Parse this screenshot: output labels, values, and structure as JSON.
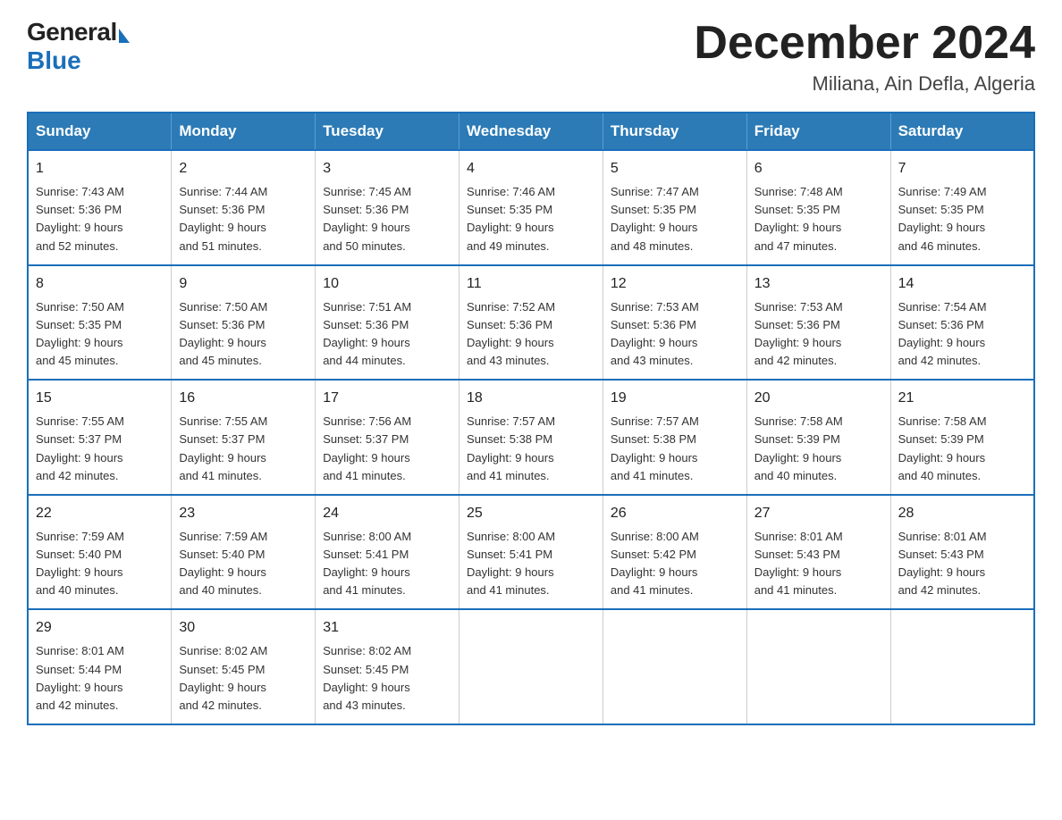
{
  "header": {
    "logo": {
      "general": "General",
      "blue": "Blue"
    },
    "title": "December 2024",
    "location": "Miliana, Ain Defla, Algeria"
  },
  "days_of_week": [
    "Sunday",
    "Monday",
    "Tuesday",
    "Wednesday",
    "Thursday",
    "Friday",
    "Saturday"
  ],
  "weeks": [
    [
      {
        "day": "1",
        "sunrise": "7:43 AM",
        "sunset": "5:36 PM",
        "daylight": "9 hours and 52 minutes."
      },
      {
        "day": "2",
        "sunrise": "7:44 AM",
        "sunset": "5:36 PM",
        "daylight": "9 hours and 51 minutes."
      },
      {
        "day": "3",
        "sunrise": "7:45 AM",
        "sunset": "5:36 PM",
        "daylight": "9 hours and 50 minutes."
      },
      {
        "day": "4",
        "sunrise": "7:46 AM",
        "sunset": "5:35 PM",
        "daylight": "9 hours and 49 minutes."
      },
      {
        "day": "5",
        "sunrise": "7:47 AM",
        "sunset": "5:35 PM",
        "daylight": "9 hours and 48 minutes."
      },
      {
        "day": "6",
        "sunrise": "7:48 AM",
        "sunset": "5:35 PM",
        "daylight": "9 hours and 47 minutes."
      },
      {
        "day": "7",
        "sunrise": "7:49 AM",
        "sunset": "5:35 PM",
        "daylight": "9 hours and 46 minutes."
      }
    ],
    [
      {
        "day": "8",
        "sunrise": "7:50 AM",
        "sunset": "5:35 PM",
        "daylight": "9 hours and 45 minutes."
      },
      {
        "day": "9",
        "sunrise": "7:50 AM",
        "sunset": "5:36 PM",
        "daylight": "9 hours and 45 minutes."
      },
      {
        "day": "10",
        "sunrise": "7:51 AM",
        "sunset": "5:36 PM",
        "daylight": "9 hours and 44 minutes."
      },
      {
        "day": "11",
        "sunrise": "7:52 AM",
        "sunset": "5:36 PM",
        "daylight": "9 hours and 43 minutes."
      },
      {
        "day": "12",
        "sunrise": "7:53 AM",
        "sunset": "5:36 PM",
        "daylight": "9 hours and 43 minutes."
      },
      {
        "day": "13",
        "sunrise": "7:53 AM",
        "sunset": "5:36 PM",
        "daylight": "9 hours and 42 minutes."
      },
      {
        "day": "14",
        "sunrise": "7:54 AM",
        "sunset": "5:36 PM",
        "daylight": "9 hours and 42 minutes."
      }
    ],
    [
      {
        "day": "15",
        "sunrise": "7:55 AM",
        "sunset": "5:37 PM",
        "daylight": "9 hours and 42 minutes."
      },
      {
        "day": "16",
        "sunrise": "7:55 AM",
        "sunset": "5:37 PM",
        "daylight": "9 hours and 41 minutes."
      },
      {
        "day": "17",
        "sunrise": "7:56 AM",
        "sunset": "5:37 PM",
        "daylight": "9 hours and 41 minutes."
      },
      {
        "day": "18",
        "sunrise": "7:57 AM",
        "sunset": "5:38 PM",
        "daylight": "9 hours and 41 minutes."
      },
      {
        "day": "19",
        "sunrise": "7:57 AM",
        "sunset": "5:38 PM",
        "daylight": "9 hours and 41 minutes."
      },
      {
        "day": "20",
        "sunrise": "7:58 AM",
        "sunset": "5:39 PM",
        "daylight": "9 hours and 40 minutes."
      },
      {
        "day": "21",
        "sunrise": "7:58 AM",
        "sunset": "5:39 PM",
        "daylight": "9 hours and 40 minutes."
      }
    ],
    [
      {
        "day": "22",
        "sunrise": "7:59 AM",
        "sunset": "5:40 PM",
        "daylight": "9 hours and 40 minutes."
      },
      {
        "day": "23",
        "sunrise": "7:59 AM",
        "sunset": "5:40 PM",
        "daylight": "9 hours and 40 minutes."
      },
      {
        "day": "24",
        "sunrise": "8:00 AM",
        "sunset": "5:41 PM",
        "daylight": "9 hours and 41 minutes."
      },
      {
        "day": "25",
        "sunrise": "8:00 AM",
        "sunset": "5:41 PM",
        "daylight": "9 hours and 41 minutes."
      },
      {
        "day": "26",
        "sunrise": "8:00 AM",
        "sunset": "5:42 PM",
        "daylight": "9 hours and 41 minutes."
      },
      {
        "day": "27",
        "sunrise": "8:01 AM",
        "sunset": "5:43 PM",
        "daylight": "9 hours and 41 minutes."
      },
      {
        "day": "28",
        "sunrise": "8:01 AM",
        "sunset": "5:43 PM",
        "daylight": "9 hours and 42 minutes."
      }
    ],
    [
      {
        "day": "29",
        "sunrise": "8:01 AM",
        "sunset": "5:44 PM",
        "daylight": "9 hours and 42 minutes."
      },
      {
        "day": "30",
        "sunrise": "8:02 AM",
        "sunset": "5:45 PM",
        "daylight": "9 hours and 42 minutes."
      },
      {
        "day": "31",
        "sunrise": "8:02 AM",
        "sunset": "5:45 PM",
        "daylight": "9 hours and 43 minutes."
      },
      null,
      null,
      null,
      null
    ]
  ],
  "labels": {
    "sunrise": "Sunrise:",
    "sunset": "Sunset:",
    "daylight": "Daylight:"
  }
}
